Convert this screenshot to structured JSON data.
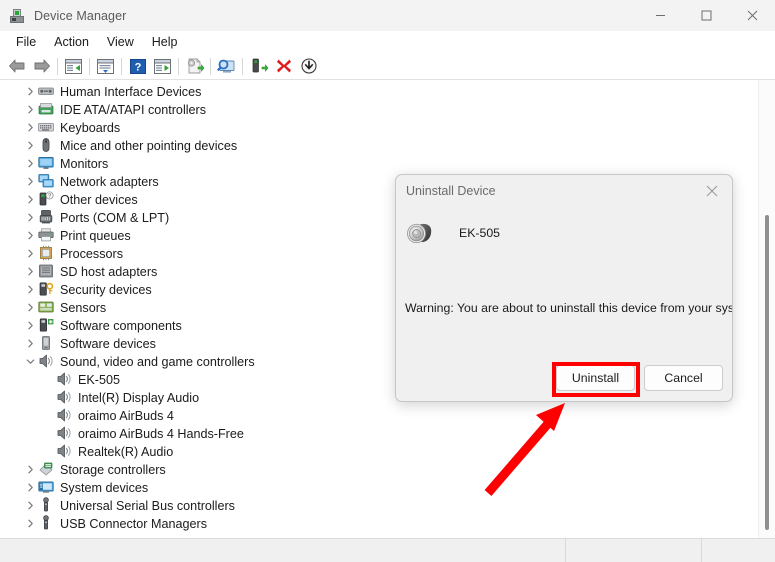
{
  "window": {
    "title": "Device Manager",
    "icon": "device-manager-icon",
    "controls": [
      {
        "name": "minimize",
        "glyph": "minimize-icon"
      },
      {
        "name": "maximize",
        "glyph": "maximize-icon"
      },
      {
        "name": "close",
        "glyph": "close-icon"
      }
    ]
  },
  "menubar": {
    "items": [
      {
        "label": "File"
      },
      {
        "label": "Action"
      },
      {
        "label": "View"
      },
      {
        "label": "Help"
      }
    ]
  },
  "toolbar": {
    "buttons": [
      {
        "name": "back-icon",
        "title": "Back"
      },
      {
        "name": "forward-icon",
        "title": "Forward"
      },
      {
        "name": "show-hide-console-tree-icon",
        "title": "Show/Hide Console Tree"
      },
      {
        "name": "properties-icon",
        "title": "Properties"
      },
      {
        "name": "help-icon",
        "title": "Help"
      },
      {
        "name": "show-hide-action-pane-icon",
        "title": "Show/Hide Action Pane"
      },
      {
        "name": "update-driver-icon",
        "title": "Update Driver Software"
      },
      {
        "name": "scan-for-hardware-changes-icon",
        "title": "Scan for hardware changes"
      },
      {
        "name": "enable-device-icon",
        "title": "Enable device"
      },
      {
        "name": "uninstall-device-icon",
        "title": "Uninstall device"
      },
      {
        "name": "disable-device-icon",
        "title": "Disable device"
      }
    ]
  },
  "tree": {
    "items": [
      {
        "label": "Human Interface Devices",
        "level": 1,
        "expandable": true,
        "expanded": false,
        "icon": "hid-icon"
      },
      {
        "label": "IDE ATA/ATAPI controllers",
        "level": 1,
        "expandable": true,
        "expanded": false,
        "icon": "ide-controller-icon"
      },
      {
        "label": "Keyboards",
        "level": 1,
        "expandable": true,
        "expanded": false,
        "icon": "keyboard-icon"
      },
      {
        "label": "Mice and other pointing devices",
        "level": 1,
        "expandable": true,
        "expanded": false,
        "icon": "mouse-icon"
      },
      {
        "label": "Monitors",
        "level": 1,
        "expandable": true,
        "expanded": false,
        "icon": "monitor-icon"
      },
      {
        "label": "Network adapters",
        "level": 1,
        "expandable": true,
        "expanded": false,
        "icon": "network-adapter-icon"
      },
      {
        "label": "Other devices",
        "level": 1,
        "expandable": true,
        "expanded": false,
        "icon": "other-device-icon"
      },
      {
        "label": "Ports (COM & LPT)",
        "level": 1,
        "expandable": true,
        "expanded": false,
        "icon": "port-icon"
      },
      {
        "label": "Print queues",
        "level": 1,
        "expandable": true,
        "expanded": false,
        "icon": "printer-icon"
      },
      {
        "label": "Processors",
        "level": 1,
        "expandable": true,
        "expanded": false,
        "icon": "processor-icon"
      },
      {
        "label": "SD host adapters",
        "level": 1,
        "expandable": true,
        "expanded": false,
        "icon": "sd-host-adapter-icon"
      },
      {
        "label": "Security devices",
        "level": 1,
        "expandable": true,
        "expanded": false,
        "icon": "security-device-icon"
      },
      {
        "label": "Sensors",
        "level": 1,
        "expandable": true,
        "expanded": false,
        "icon": "sensor-icon"
      },
      {
        "label": "Software components",
        "level": 1,
        "expandable": true,
        "expanded": false,
        "icon": "software-component-icon"
      },
      {
        "label": "Software devices",
        "level": 1,
        "expandable": true,
        "expanded": false,
        "icon": "software-device-icon"
      },
      {
        "label": "Sound, video and game controllers",
        "level": 1,
        "expandable": true,
        "expanded": true,
        "icon": "speaker-icon"
      },
      {
        "label": "EK-505",
        "level": 2,
        "expandable": false,
        "expanded": false,
        "icon": "speaker-icon"
      },
      {
        "label": "Intel(R) Display Audio",
        "level": 2,
        "expandable": false,
        "expanded": false,
        "icon": "speaker-icon"
      },
      {
        "label": "oraimo AirBuds 4",
        "level": 2,
        "expandable": false,
        "expanded": false,
        "icon": "speaker-icon"
      },
      {
        "label": "oraimo AirBuds 4 Hands-Free",
        "level": 2,
        "expandable": false,
        "expanded": false,
        "icon": "speaker-icon"
      },
      {
        "label": "Realtek(R) Audio",
        "level": 2,
        "expandable": false,
        "expanded": false,
        "icon": "speaker-icon"
      },
      {
        "label": "Storage controllers",
        "level": 1,
        "expandable": true,
        "expanded": false,
        "icon": "storage-controller-icon"
      },
      {
        "label": "System devices",
        "level": 1,
        "expandable": true,
        "expanded": false,
        "icon": "system-device-icon"
      },
      {
        "label": "Universal Serial Bus controllers",
        "level": 1,
        "expandable": true,
        "expanded": false,
        "icon": "usb-icon"
      },
      {
        "label": "USB Connector Managers",
        "level": 1,
        "expandable": true,
        "expanded": false,
        "icon": "usb-icon"
      }
    ]
  },
  "dialog": {
    "title": "Uninstall Device",
    "device_name": "EK-505",
    "device_icon": "speaker-device-icon",
    "warning": "Warning: You are about to uninstall this device from your system.",
    "buttons": [
      {
        "label": "Uninstall",
        "name": "uninstall-button",
        "highlighted": true
      },
      {
        "label": "Cancel",
        "name": "cancel-button",
        "highlighted": false
      }
    ],
    "close_icon": "close-icon"
  },
  "annotations": {
    "highlight_color": "#fe0000",
    "arrow_color": "#fe0000",
    "highlight_target": "Uninstall",
    "arrow_points_to": "Uninstall"
  },
  "statusbar": {
    "cells": [
      "",
      "",
      ""
    ]
  }
}
